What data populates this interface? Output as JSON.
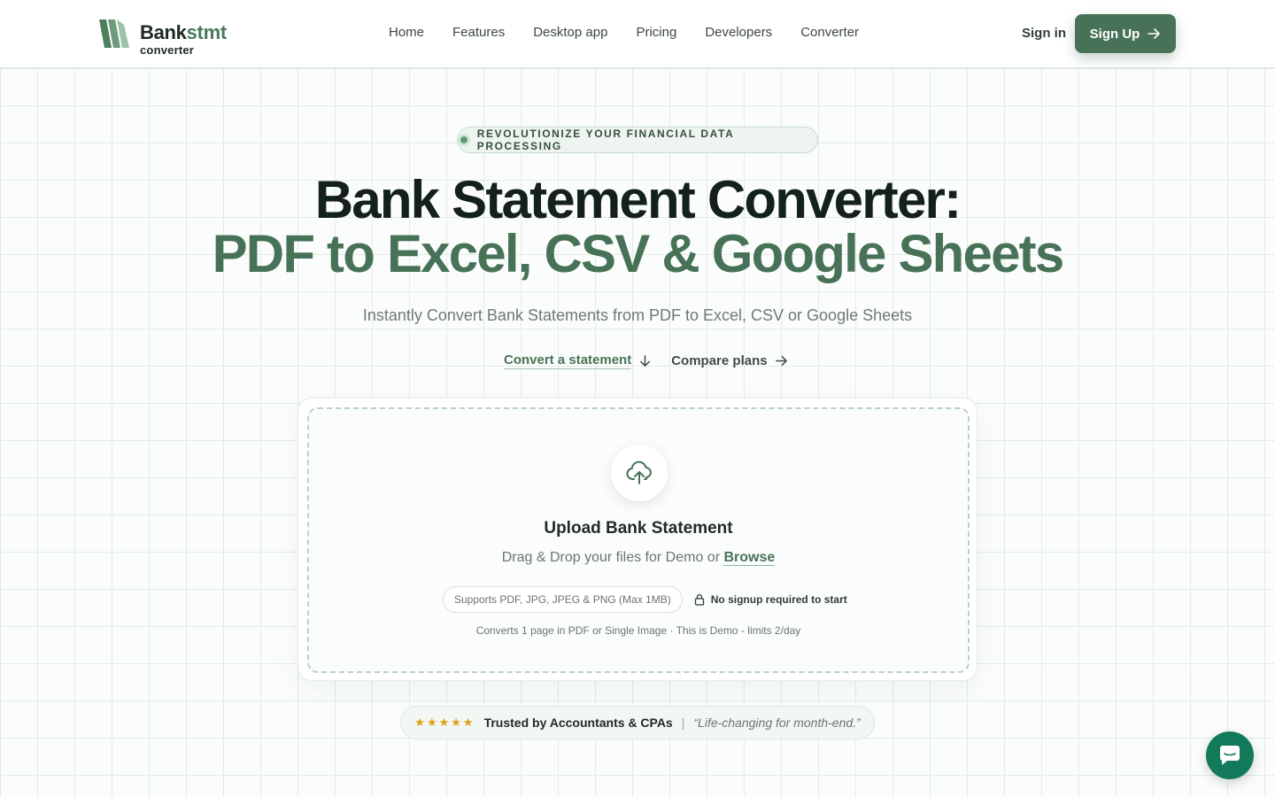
{
  "brand": {
    "name_part1": "Bank",
    "name_part2": "stmt",
    "tagline": "converter",
    "accent_color": "#487257"
  },
  "nav": {
    "items": [
      {
        "label": "Home"
      },
      {
        "label": "Features"
      },
      {
        "label": "Desktop app"
      },
      {
        "label": "Pricing"
      },
      {
        "label": "Developers"
      },
      {
        "label": "Converter"
      }
    ],
    "signin_label": "Sign in",
    "signup_label": "Sign Up"
  },
  "hero": {
    "badge": "REVOLUTIONIZE YOUR FINANCIAL DATA PROCESSING",
    "title_line1": "Bank Statement Converter:",
    "title_line2": "PDF to Excel, CSV & Google Sheets",
    "subtitle": "Instantly Convert Bank Statements from PDF to Excel, CSV or Google Sheets",
    "cta_primary": "Convert a statement",
    "cta_secondary": "Compare plans"
  },
  "upload": {
    "title": "Upload Bank Statement",
    "prompt": "Drag & Drop your files for Demo or",
    "browse_label": "Browse",
    "supports": "Supports PDF, JPG, JPEG & PNG (Max 1MB)",
    "no_signup": "No signup required to start",
    "note": "Converts 1 page in PDF or Single Image · This is Demo - limits 2/day"
  },
  "trust": {
    "stars": "★★★★★",
    "title": "Trusted by Accountants & CPAs",
    "separator": "|",
    "quote": "“Life-changing for month-end.”"
  },
  "icons": {
    "upload": "cloud-upload-icon",
    "lock": "lock-icon",
    "chat": "chat-icon",
    "arrow_down": "arrow-down-icon",
    "arrow_right": "arrow-right-icon"
  },
  "colors": {
    "primary": "#487257",
    "title_dark": "#14211a",
    "star": "#e0a012",
    "chat": "#127a5a"
  }
}
